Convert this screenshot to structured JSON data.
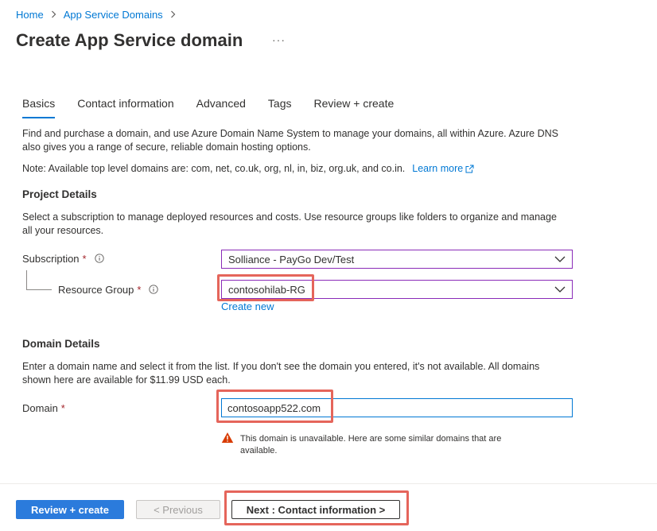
{
  "breadcrumb": {
    "items": [
      {
        "label": "Home"
      },
      {
        "label": "App Service Domains"
      }
    ]
  },
  "page": {
    "title": "Create App Service domain",
    "more_label": "···"
  },
  "tabs": [
    {
      "label": "Basics",
      "active": true
    },
    {
      "label": "Contact information",
      "active": false
    },
    {
      "label": "Advanced",
      "active": false
    },
    {
      "label": "Tags",
      "active": false
    },
    {
      "label": "Review + create",
      "active": false
    }
  ],
  "intro": {
    "description_line1": "Find and purchase a domain, and use Azure Domain Name System to manage your domains, all within Azure. Azure DNS",
    "description_line2": "also gives you a range of secure, reliable domain hosting options.",
    "note": "Note: Available top level domains are: com, net, co.uk, org, nl, in, biz, org.uk, and co.in.",
    "learn_more": "Learn more"
  },
  "project_details": {
    "heading": "Project Details",
    "description_line1": "Select a subscription to manage deployed resources and costs. Use resource groups like folders to organize and manage",
    "description_line2": "all your resources.",
    "subscription": {
      "label": "Subscription",
      "required_mark": "*",
      "value": "Solliance - PayGo Dev/Test"
    },
    "resource_group": {
      "label": "Resource Group",
      "required_mark": "*",
      "value": "contosohilab-RG",
      "create_new": "Create new"
    }
  },
  "domain_details": {
    "heading": "Domain Details",
    "description_line1": "Enter a domain name and select it from the list. If you don't see the domain you entered, it's not available. All domains",
    "description_line2": "shown here are available for $11.99 USD each.",
    "domain": {
      "label": "Domain",
      "required_mark": "*",
      "value": "contosoapp522.com"
    },
    "warning_line1": "This domain is unavailable. Here are some similar domains that are",
    "warning_line2": "available."
  },
  "footer": {
    "review_create": "Review + create",
    "previous": "< Previous",
    "next": "Next : Contact information >"
  },
  "colors": {
    "accent": "#0078d4",
    "primary_button": "#2b7bdc",
    "highlight": "#e5655b",
    "required": "#a4262c",
    "warning": "#d83b01",
    "dropdown_border": "#8a2bb8"
  }
}
